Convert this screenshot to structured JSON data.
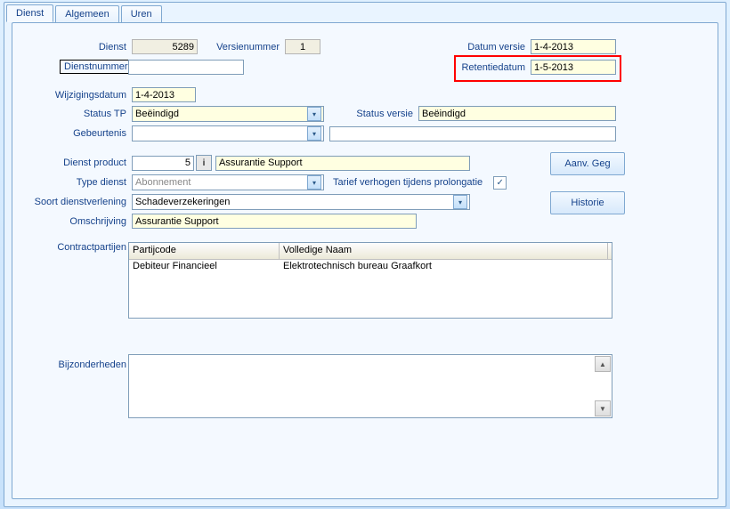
{
  "tabs": {
    "dienst": "Dienst",
    "algemeen": "Algemeen",
    "uren": "Uren"
  },
  "labels": {
    "dienst": "Dienst",
    "versienummer": "Versienummer",
    "datum_versie": "Datum versie",
    "dienstnummer": "Dienstnummer",
    "retentiedatum": "Retentiedatum",
    "wijzigingsdatum": "Wijzigingsdatum",
    "status_tp": "Status TP",
    "status_versie": "Status versie",
    "gebeurtenis": "Gebeurtenis",
    "dienst_product": "Dienst product",
    "type_dienst": "Type dienst",
    "tarief_verhogen": "Tarief verhogen tijdens prolongatie",
    "soort_dienstverlening": "Soort dienstverlening",
    "omschrijving": "Omschrijving",
    "contractpartijen": "Contractpartijen",
    "bijzonderheden": "Bijzonderheden"
  },
  "values": {
    "dienst": "5289",
    "versienummer": "1",
    "datum_versie": "1-4-2013",
    "dienstnummer": "",
    "retentiedatum": "1-5-2013",
    "wijzigingsdatum": "1-4-2013",
    "status_tp": "Beëindigd",
    "status_versie": "Beëindigd",
    "gebeurtenis": "",
    "gebeurtenis_text": "",
    "dienst_product_code": "5",
    "dienst_product_naam": "Assurantie Support",
    "type_dienst": "Abonnement",
    "soort_dienstverlening": "Schadeverzekeringen",
    "omschrijving": "Assurantie Support",
    "bijzonderheden": "",
    "tarief_verhogen_checked": true
  },
  "table": {
    "headers": {
      "partijcode": "Partijcode",
      "volledige_naam": "Volledige Naam"
    },
    "rows": [
      {
        "partijcode": "Debiteur Financieel",
        "volledige_naam": "Elektrotechnisch bureau Graafkort"
      }
    ]
  },
  "buttons": {
    "info": "i",
    "aanv_geg": "Aanv. Geg",
    "historie": "Historie"
  },
  "icons": {
    "dropdown": "▾",
    "up": "▲",
    "down": "▼",
    "check": "✓"
  }
}
